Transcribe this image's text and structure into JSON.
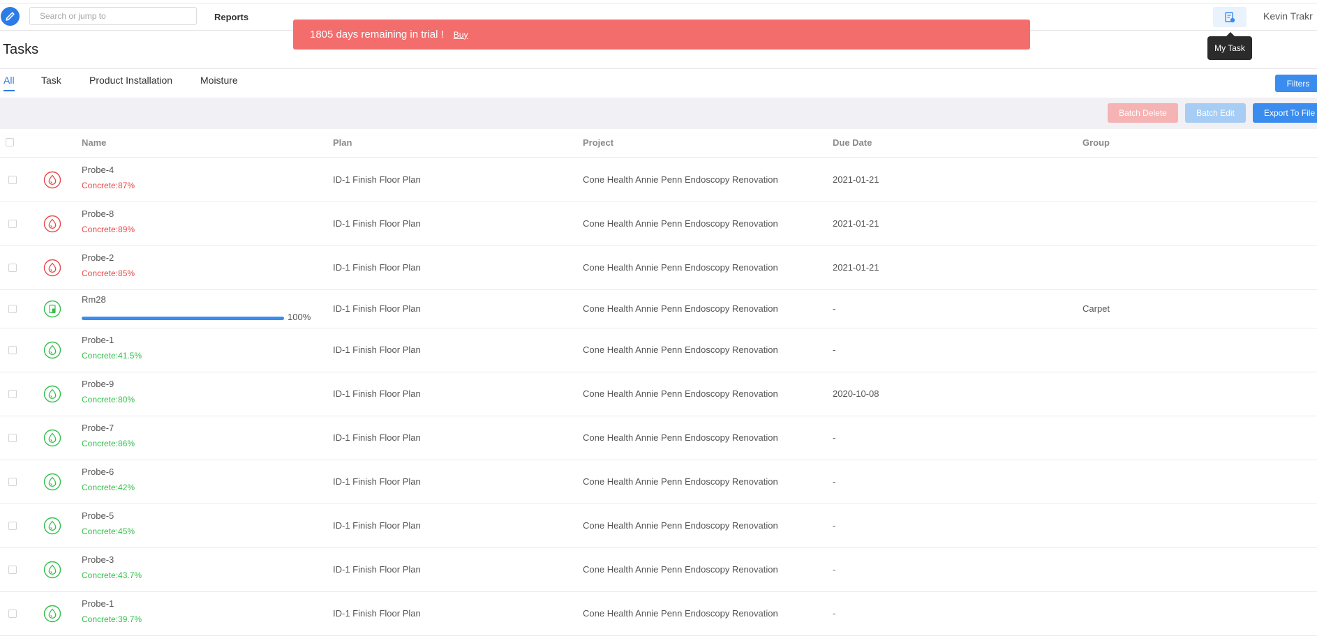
{
  "header": {
    "search_placeholder": "Search or jump to",
    "nav_reports": "Reports",
    "user_name": "Kevin Trakr",
    "tooltip": "My Task"
  },
  "trial_banner": {
    "text": "1805 days remaining in trial !",
    "buy_label": "Buy",
    "color": "#f46d6d"
  },
  "page": {
    "title": "Tasks",
    "tabs": [
      "All",
      "Task",
      "Product Installation",
      "Moisture"
    ],
    "active_tab": "All",
    "filters_label": "Filters"
  },
  "toolbar": {
    "batch_delete": "Batch Delete",
    "batch_edit": "Batch Edit",
    "export": "Export To File"
  },
  "table": {
    "columns": [
      "Name",
      "Plan",
      "Project",
      "Due Date",
      "Group"
    ],
    "rows": [
      {
        "name": "Probe-4",
        "sub": "Concrete:87%",
        "status": "red",
        "icon": "moisture-drop-icon",
        "plan": "ID-1 Finish Floor Plan",
        "project": "Cone Health Annie Penn Endoscopy Renovation",
        "due": "2021-01-21",
        "group": ""
      },
      {
        "name": "Probe-8",
        "sub": "Concrete:89%",
        "status": "red",
        "icon": "moisture-drop-icon",
        "plan": "ID-1 Finish Floor Plan",
        "project": "Cone Health Annie Penn Endoscopy Renovation",
        "due": "2021-01-21",
        "group": ""
      },
      {
        "name": "Probe-2",
        "sub": "Concrete:85%",
        "status": "red",
        "icon": "moisture-drop-icon",
        "plan": "ID-1 Finish Floor Plan",
        "project": "Cone Health Annie Penn Endoscopy Renovation",
        "due": "2021-01-21",
        "group": ""
      },
      {
        "name": "Rm28",
        "progress": 1.0,
        "progress_label": "100%",
        "status": "green",
        "icon": "installation-icon",
        "plan": "ID-1 Finish Floor Plan",
        "project": "Cone Health Annie Penn Endoscopy Renovation",
        "due": "-",
        "group": "Carpet"
      },
      {
        "name": "Probe-1",
        "sub": "Concrete:41.5%",
        "status": "green",
        "icon": "moisture-drop-icon",
        "plan": "ID-1 Finish Floor Plan",
        "project": "Cone Health Annie Penn Endoscopy Renovation",
        "due": "-",
        "group": ""
      },
      {
        "name": "Probe-9",
        "sub": "Concrete:80%",
        "status": "green",
        "icon": "moisture-drop-icon",
        "plan": "ID-1 Finish Floor Plan",
        "project": "Cone Health Annie Penn Endoscopy Renovation",
        "due": "2020-10-08",
        "group": ""
      },
      {
        "name": "Probe-7",
        "sub": "Concrete:86%",
        "status": "green",
        "icon": "moisture-drop-icon",
        "plan": "ID-1 Finish Floor Plan",
        "project": "Cone Health Annie Penn Endoscopy Renovation",
        "due": "-",
        "group": ""
      },
      {
        "name": "Probe-6",
        "sub": "Concrete:42%",
        "status": "green",
        "icon": "moisture-drop-icon",
        "plan": "ID-1 Finish Floor Plan",
        "project": "Cone Health Annie Penn Endoscopy Renovation",
        "due": "-",
        "group": ""
      },
      {
        "name": "Probe-5",
        "sub": "Concrete:45%",
        "status": "green",
        "icon": "moisture-drop-icon",
        "plan": "ID-1 Finish Floor Plan",
        "project": "Cone Health Annie Penn Endoscopy Renovation",
        "due": "-",
        "group": ""
      },
      {
        "name": "Probe-3",
        "sub": "Concrete:43.7%",
        "status": "green",
        "icon": "moisture-drop-icon",
        "plan": "ID-1 Finish Floor Plan",
        "project": "Cone Health Annie Penn Endoscopy Renovation",
        "due": "-",
        "group": ""
      },
      {
        "name": "Probe-1",
        "sub": "Concrete:39.7%",
        "status": "green",
        "icon": "moisture-drop-icon",
        "plan": "ID-1 Finish Floor Plan",
        "project": "Cone Health Annie Penn Endoscopy Renovation",
        "due": "-",
        "group": ""
      }
    ]
  },
  "colors": {
    "accent": "#3b8cef",
    "danger": "#ea4848",
    "success": "#33c04a"
  }
}
